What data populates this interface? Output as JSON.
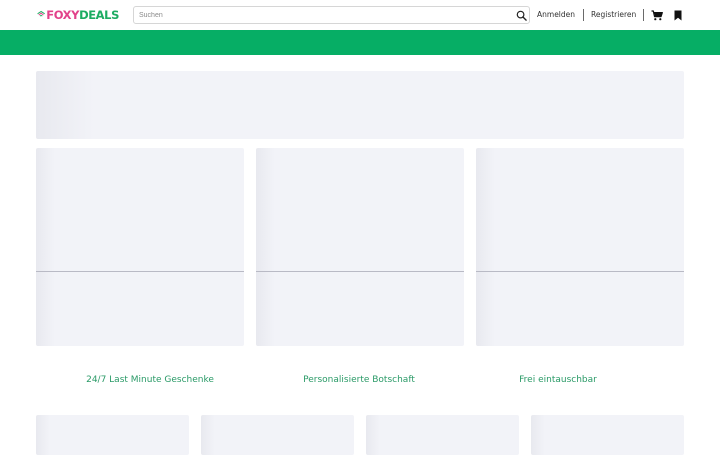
{
  "header": {
    "logo": {
      "part1": "FOXY",
      "part2": "DEALS"
    },
    "search": {
      "placeholder": "Suchen"
    },
    "login_label": "Anmelden",
    "register_label": "Registrieren",
    "icons": [
      "search-icon",
      "cart-icon",
      "bookmark-icon"
    ]
  },
  "colors": {
    "brand_green": "#06ae65",
    "logo_pink": "#e2418a",
    "logo_green": "#1dac62",
    "feature_text": "#2a9a67",
    "skeleton": "#f2f3f8"
  },
  "features": [
    {
      "label": "24/7 Last Minute Geschenke"
    },
    {
      "label": "Personalisierte Botschaft"
    },
    {
      "label": "Frei eintauschbar"
    }
  ]
}
